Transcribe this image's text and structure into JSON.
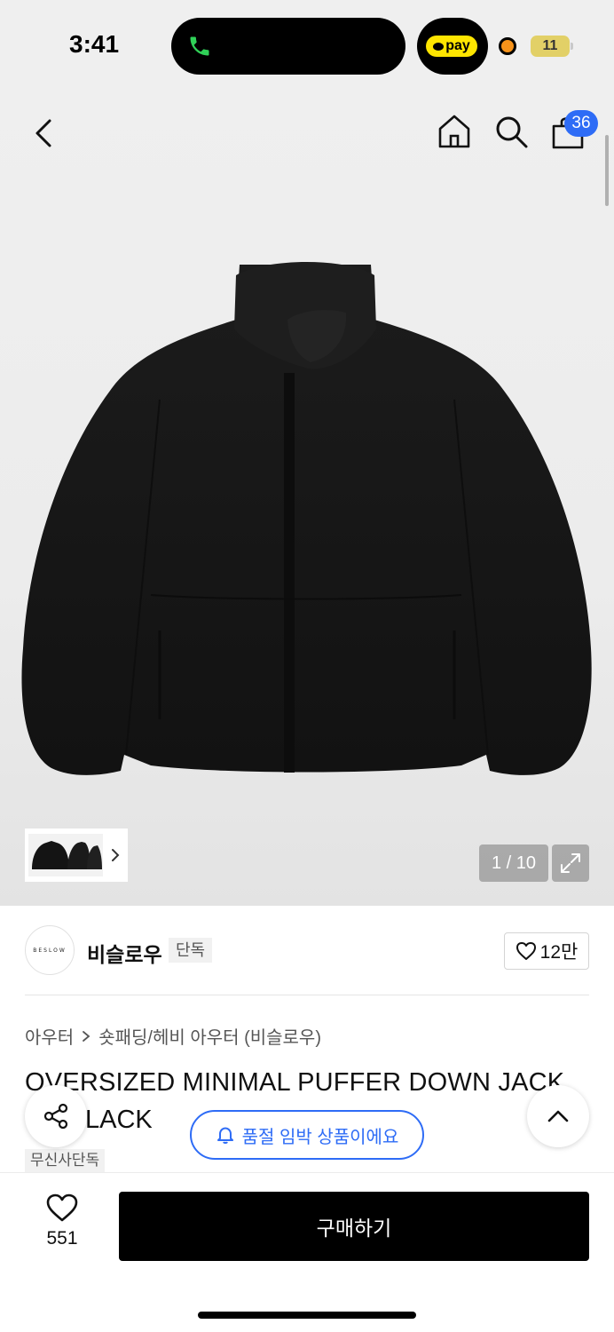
{
  "status_bar": {
    "time": "3:41",
    "pay_label": "pay",
    "battery": "11"
  },
  "header": {
    "cart_count": "36"
  },
  "gallery": {
    "counter": "1 / 10"
  },
  "brand": {
    "logo_text": "BESLOW",
    "name": "비슬로우",
    "tag": "단독",
    "like_count": "12만"
  },
  "breadcrumb": {
    "items": [
      "아우터",
      "숏패딩/헤비 아우터 (비슬로우)"
    ]
  },
  "product": {
    "title_line1": "OVERSIZED MINIMAL PUFFER DOWN JACK",
    "title_line2": "LACK",
    "exclusive_tag": "무신사단독"
  },
  "restock": {
    "label": "품절 임박 상품이에요"
  },
  "bottom_bar": {
    "like_count": "551",
    "buy_label": "구매하기"
  },
  "colors": {
    "accent": "#2e6cf6",
    "buy_button": "#000000",
    "pay_badge": "#fee500"
  }
}
